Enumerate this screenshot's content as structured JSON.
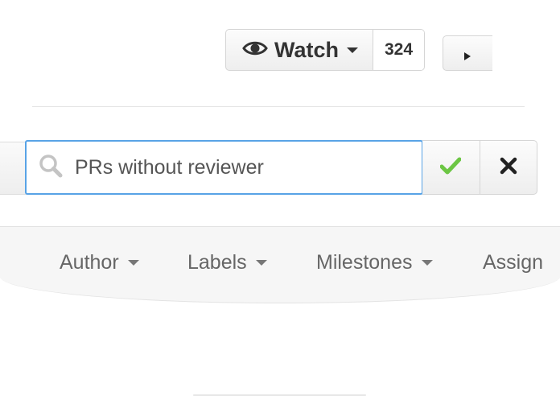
{
  "repo_header": {
    "watch_label": "Watch",
    "watch_count": "324"
  },
  "search": {
    "query": "PRs without reviewer",
    "icons": [
      "search-icon",
      "check-icon",
      "close-icon"
    ],
    "accent_color": "#58a3e6",
    "check_color": "#6cc644"
  },
  "filters": {
    "items": [
      {
        "label": "Author"
      },
      {
        "label": "Labels"
      },
      {
        "label": "Milestones"
      },
      {
        "label": "Assign"
      }
    ]
  }
}
